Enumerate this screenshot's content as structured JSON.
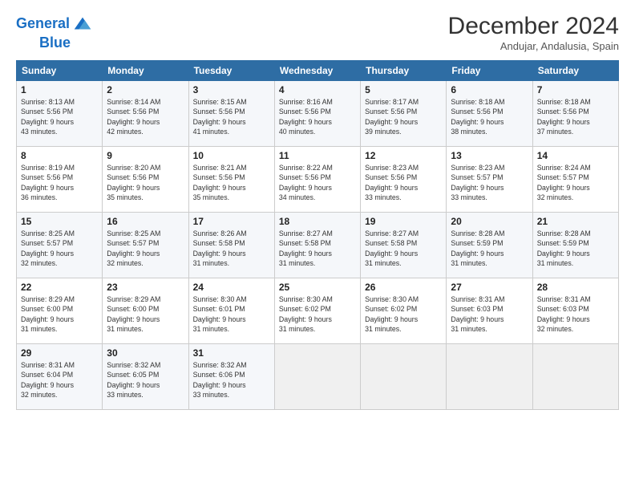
{
  "header": {
    "logo_line1": "General",
    "logo_line2": "Blue",
    "month": "December 2024",
    "location": "Andujar, Andalusia, Spain"
  },
  "weekdays": [
    "Sunday",
    "Monday",
    "Tuesday",
    "Wednesday",
    "Thursday",
    "Friday",
    "Saturday"
  ],
  "weeks": [
    [
      {
        "day": "1",
        "sunrise": "8:13 AM",
        "sunset": "5:56 PM",
        "daylight": "9 hours and 43 minutes."
      },
      {
        "day": "2",
        "sunrise": "8:14 AM",
        "sunset": "5:56 PM",
        "daylight": "9 hours and 42 minutes."
      },
      {
        "day": "3",
        "sunrise": "8:15 AM",
        "sunset": "5:56 PM",
        "daylight": "9 hours and 41 minutes."
      },
      {
        "day": "4",
        "sunrise": "8:16 AM",
        "sunset": "5:56 PM",
        "daylight": "9 hours and 40 minutes."
      },
      {
        "day": "5",
        "sunrise": "8:17 AM",
        "sunset": "5:56 PM",
        "daylight": "9 hours and 39 minutes."
      },
      {
        "day": "6",
        "sunrise": "8:18 AM",
        "sunset": "5:56 PM",
        "daylight": "9 hours and 38 minutes."
      },
      {
        "day": "7",
        "sunrise": "8:18 AM",
        "sunset": "5:56 PM",
        "daylight": "9 hours and 37 minutes."
      }
    ],
    [
      {
        "day": "8",
        "sunrise": "8:19 AM",
        "sunset": "5:56 PM",
        "daylight": "9 hours and 36 minutes."
      },
      {
        "day": "9",
        "sunrise": "8:20 AM",
        "sunset": "5:56 PM",
        "daylight": "9 hours and 35 minutes."
      },
      {
        "day": "10",
        "sunrise": "8:21 AM",
        "sunset": "5:56 PM",
        "daylight": "9 hours and 35 minutes."
      },
      {
        "day": "11",
        "sunrise": "8:22 AM",
        "sunset": "5:56 PM",
        "daylight": "9 hours and 34 minutes."
      },
      {
        "day": "12",
        "sunrise": "8:23 AM",
        "sunset": "5:56 PM",
        "daylight": "9 hours and 33 minutes."
      },
      {
        "day": "13",
        "sunrise": "8:23 AM",
        "sunset": "5:57 PM",
        "daylight": "9 hours and 33 minutes."
      },
      {
        "day": "14",
        "sunrise": "8:24 AM",
        "sunset": "5:57 PM",
        "daylight": "9 hours and 32 minutes."
      }
    ],
    [
      {
        "day": "15",
        "sunrise": "8:25 AM",
        "sunset": "5:57 PM",
        "daylight": "9 hours and 32 minutes."
      },
      {
        "day": "16",
        "sunrise": "8:25 AM",
        "sunset": "5:57 PM",
        "daylight": "9 hours and 32 minutes."
      },
      {
        "day": "17",
        "sunrise": "8:26 AM",
        "sunset": "5:58 PM",
        "daylight": "9 hours and 31 minutes."
      },
      {
        "day": "18",
        "sunrise": "8:27 AM",
        "sunset": "5:58 PM",
        "daylight": "9 hours and 31 minutes."
      },
      {
        "day": "19",
        "sunrise": "8:27 AM",
        "sunset": "5:58 PM",
        "daylight": "9 hours and 31 minutes."
      },
      {
        "day": "20",
        "sunrise": "8:28 AM",
        "sunset": "5:59 PM",
        "daylight": "9 hours and 31 minutes."
      },
      {
        "day": "21",
        "sunrise": "8:28 AM",
        "sunset": "5:59 PM",
        "daylight": "9 hours and 31 minutes."
      }
    ],
    [
      {
        "day": "22",
        "sunrise": "8:29 AM",
        "sunset": "6:00 PM",
        "daylight": "9 hours and 31 minutes."
      },
      {
        "day": "23",
        "sunrise": "8:29 AM",
        "sunset": "6:00 PM",
        "daylight": "9 hours and 31 minutes."
      },
      {
        "day": "24",
        "sunrise": "8:30 AM",
        "sunset": "6:01 PM",
        "daylight": "9 hours and 31 minutes."
      },
      {
        "day": "25",
        "sunrise": "8:30 AM",
        "sunset": "6:02 PM",
        "daylight": "9 hours and 31 minutes."
      },
      {
        "day": "26",
        "sunrise": "8:30 AM",
        "sunset": "6:02 PM",
        "daylight": "9 hours and 31 minutes."
      },
      {
        "day": "27",
        "sunrise": "8:31 AM",
        "sunset": "6:03 PM",
        "daylight": "9 hours and 31 minutes."
      },
      {
        "day": "28",
        "sunrise": "8:31 AM",
        "sunset": "6:03 PM",
        "daylight": "9 hours and 32 minutes."
      }
    ],
    [
      {
        "day": "29",
        "sunrise": "8:31 AM",
        "sunset": "6:04 PM",
        "daylight": "9 hours and 32 minutes."
      },
      {
        "day": "30",
        "sunrise": "8:32 AM",
        "sunset": "6:05 PM",
        "daylight": "9 hours and 33 minutes."
      },
      {
        "day": "31",
        "sunrise": "8:32 AM",
        "sunset": "6:06 PM",
        "daylight": "9 hours and 33 minutes."
      },
      null,
      null,
      null,
      null
    ]
  ]
}
